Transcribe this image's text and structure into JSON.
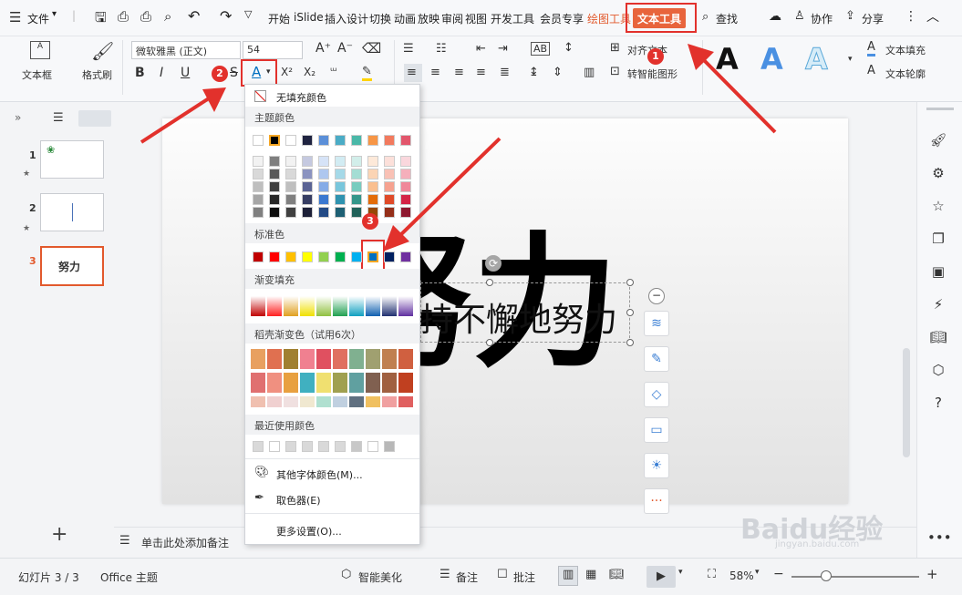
{
  "menu": {
    "file": "文件",
    "tabs": [
      "开始",
      "iSlide",
      "插入",
      "设计",
      "切换",
      "动画",
      "放映",
      "审阅",
      "视图",
      "开发工具",
      "会员专享"
    ],
    "drawing_tool": "绘图工具",
    "text_tool": "文本工具",
    "search": "查找",
    "collab": "协作",
    "share": "分享"
  },
  "ribbon": {
    "textbox": "文本框",
    "format_painter": "格式刷",
    "font_name": "微软雅黑 (正文)",
    "font_size": "54",
    "align_text": "对齐文本",
    "smart_shape": "转智能图形",
    "text_fill": "文本填充",
    "text_outline": "文本轮廓",
    "style_sample": "A",
    "bold": "B",
    "italic": "I",
    "underline": "U",
    "strike": "S",
    "font_color": "A",
    "superscript": "X²",
    "subscript": "X₂",
    "grow": "A⁺",
    "shrink": "A⁻"
  },
  "popup": {
    "no_fill": "无填充颜色",
    "theme_colors": "主题颜色",
    "standard": "标准色",
    "gradient": "渐变填充",
    "daoke": "稻壳渐变色（试用6次）",
    "recent": "最近使用颜色",
    "more_colors": "其他字体颜色(M)...",
    "picker": "取色器(E)",
    "more_settings": "更多设置(O)..."
  },
  "slide": {
    "big_text": "努力",
    "sub_text": "持不懈地努力"
  },
  "thumbs": [
    {
      "num": "1"
    },
    {
      "num": "2"
    },
    {
      "num": "3",
      "label": "努力"
    }
  ],
  "notes": {
    "placeholder": "单击此处添加备注"
  },
  "status": {
    "slide": "幻灯片 3 / 3",
    "theme": "Office 主题",
    "beautify": "智能美化",
    "notes": "备注",
    "comment": "批注",
    "zoom": "58%"
  },
  "badges": [
    "1",
    "2",
    "3"
  ],
  "watermark": "Baidu经验",
  "watermark_sub": "jingyan.baidu.com",
  "colors": {
    "accent": "#e2312c",
    "selection": "#0070c0"
  }
}
